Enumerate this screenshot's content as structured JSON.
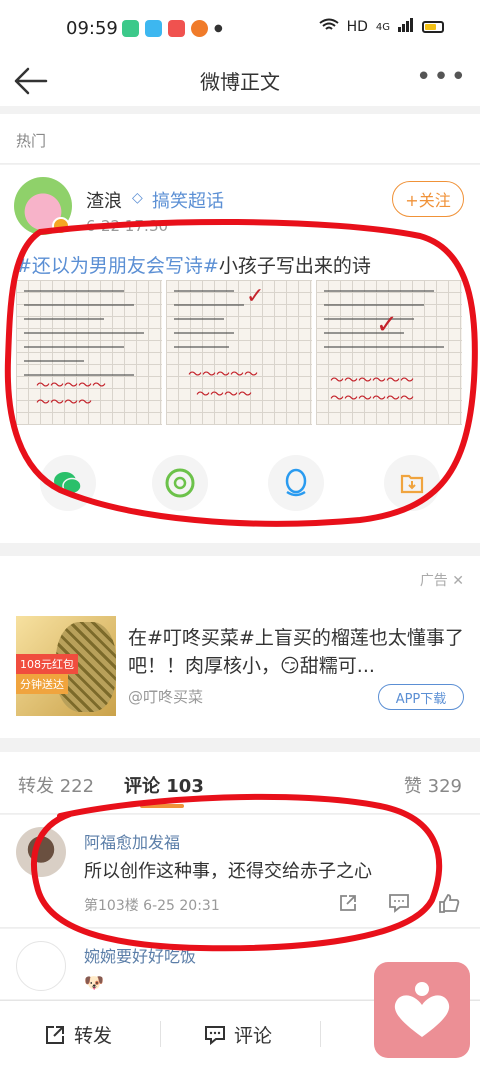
{
  "status_bar": {
    "time": "09:59",
    "network": "HD",
    "signal": "4G"
  },
  "nav": {
    "title": "微博正文",
    "more": "•••"
  },
  "section": {
    "hot_label": "热门"
  },
  "post": {
    "user_name": "渣浪",
    "topic": "搞笑超话",
    "time": "6-22 17:30",
    "follow_label": "+关注",
    "hashtag": "#还以为男朋友会写诗#",
    "text": "小孩子写出来的诗"
  },
  "ad": {
    "label": "广告",
    "text": "在#叮咚买菜#上盲买的榴莲也太懂事了吧！！肉厚核小，😏甜糯可...",
    "source": "@叮咚买菜",
    "button": "APP下载",
    "img_tag1": "108元红包",
    "img_tag2": "分钟送达"
  },
  "tabs": {
    "repost": "转发 222",
    "comment": "评论 103",
    "like": "赞 329"
  },
  "comments": [
    {
      "name": "阿福愈加发福",
      "text": "所以创作这种事，还得交给赤子之心",
      "meta": "第103楼  6-25 20:31"
    },
    {
      "name": "婉婉要好好吃饭",
      "emoji": "🐶"
    }
  ],
  "bottom_bar": {
    "repost": "转发",
    "comment": "评论"
  },
  "colors": {
    "link": "#5b8fd4",
    "accent": "#f09238",
    "annotation": "#e8101a"
  }
}
